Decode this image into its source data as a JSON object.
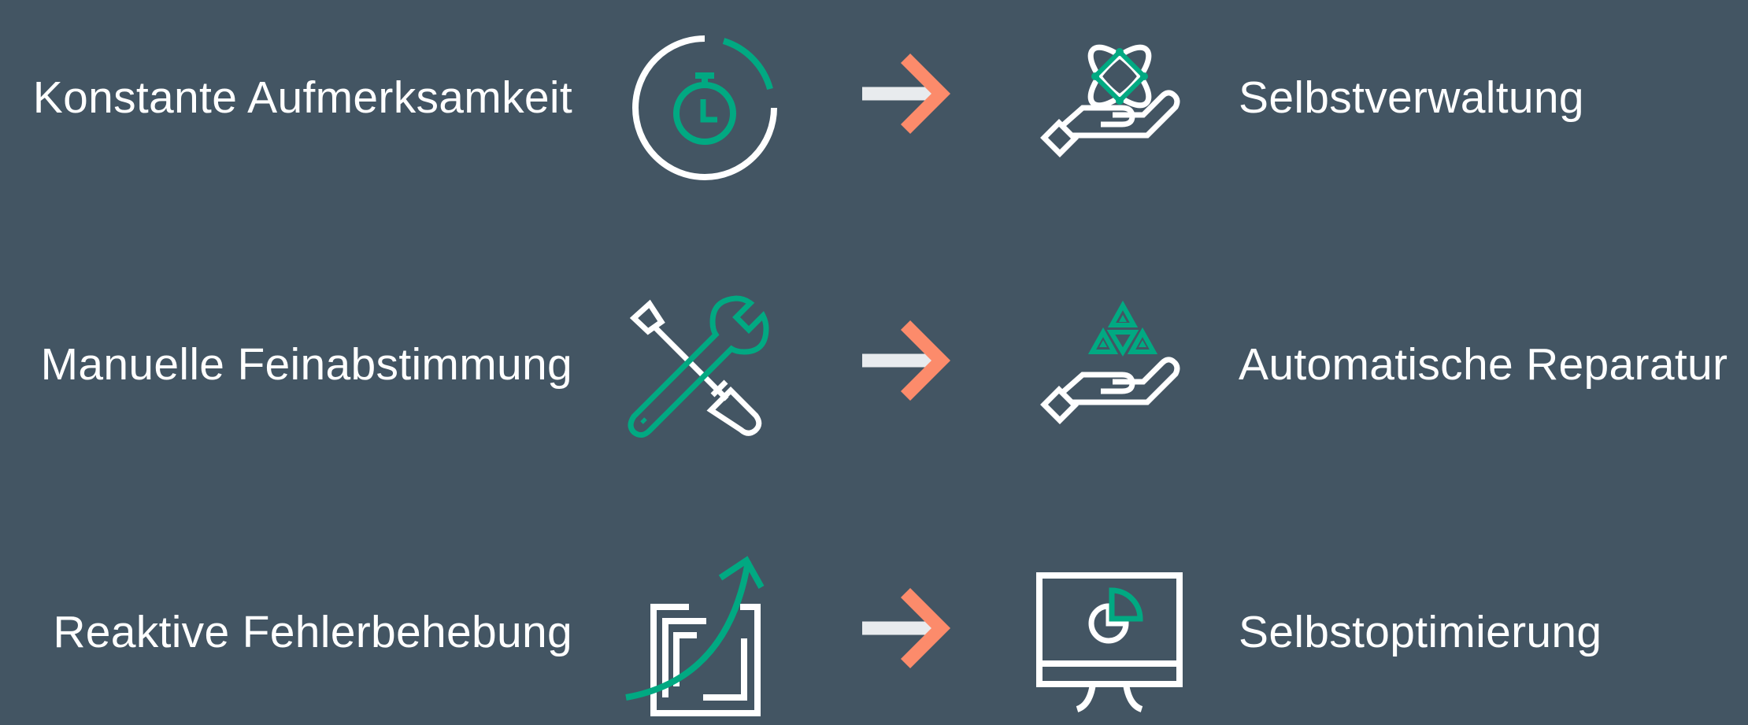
{
  "colors": {
    "background": "#435563",
    "text": "#ffffff",
    "accent_green": "#01a982",
    "arrow_orange": "#fc8b6b",
    "arrow_shaft": "#e8ebee"
  },
  "rows": [
    {
      "from_label": "Konstante Aufmerksamkeit",
      "from_icon": "stopwatch-icon",
      "to_label": "Selbstverwaltung",
      "to_icon": "hand-atom-icon"
    },
    {
      "from_label": "Manuelle Feinabstimmung",
      "from_icon": "wrench-screwdriver-icon",
      "to_label": "Automatische Reparatur",
      "to_icon": "hand-triangles-icon"
    },
    {
      "from_label": "Reaktive Fehlerbehebung",
      "from_icon": "growth-arrow-icon",
      "to_label": "Selbstoptimierung",
      "to_icon": "monitor-chart-icon"
    }
  ]
}
